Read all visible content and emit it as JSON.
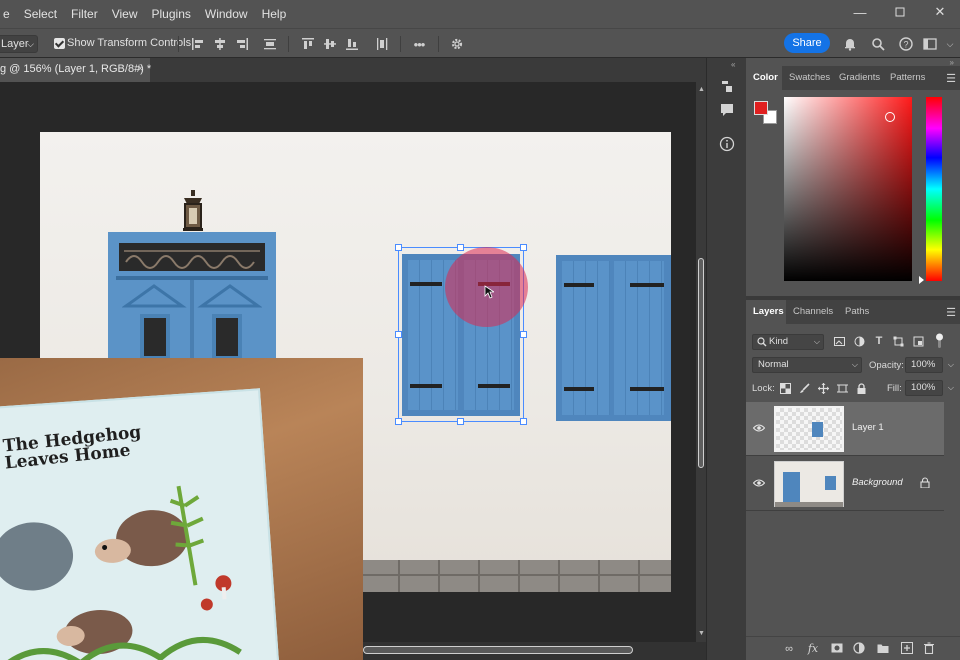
{
  "menubar": {
    "items": [
      "e",
      "Select",
      "Filter",
      "View",
      "Plugins",
      "Window",
      "Help"
    ],
    "window_controls": [
      "minimize-icon",
      "maximize-icon",
      "close-icon"
    ]
  },
  "options": {
    "layer_select": "Layer",
    "show_transform_controls": "Show Transform Controls",
    "show_transform_checked": true,
    "more": "•••",
    "share_label": "Share"
  },
  "document": {
    "tab_title": "g @ 156% (Layer 1, RGB/8#) *",
    "close": "×"
  },
  "webcam": {
    "book_title": "The Hedgehog\nLeaves Home"
  },
  "color_panel": {
    "tabs": [
      "Color",
      "Swatches",
      "Gradients",
      "Patterns"
    ],
    "active_tab": "Color",
    "foreground_color": "#e02020",
    "background_color": "#ffffff"
  },
  "layers_panel": {
    "tabs": [
      "Layers",
      "Channels",
      "Paths"
    ],
    "active_tab": "Layers",
    "kind_filter": "Kind",
    "blend_mode": "Normal",
    "opacity_label": "Opacity:",
    "opacity_value": "100%",
    "lock_label": "Lock:",
    "fill_label": "Fill:",
    "fill_value": "100%",
    "layers": [
      {
        "name": "Layer 1",
        "selected": true,
        "visible": true
      },
      {
        "name": "Background",
        "selected": false,
        "visible": true,
        "locked": true
      }
    ]
  }
}
